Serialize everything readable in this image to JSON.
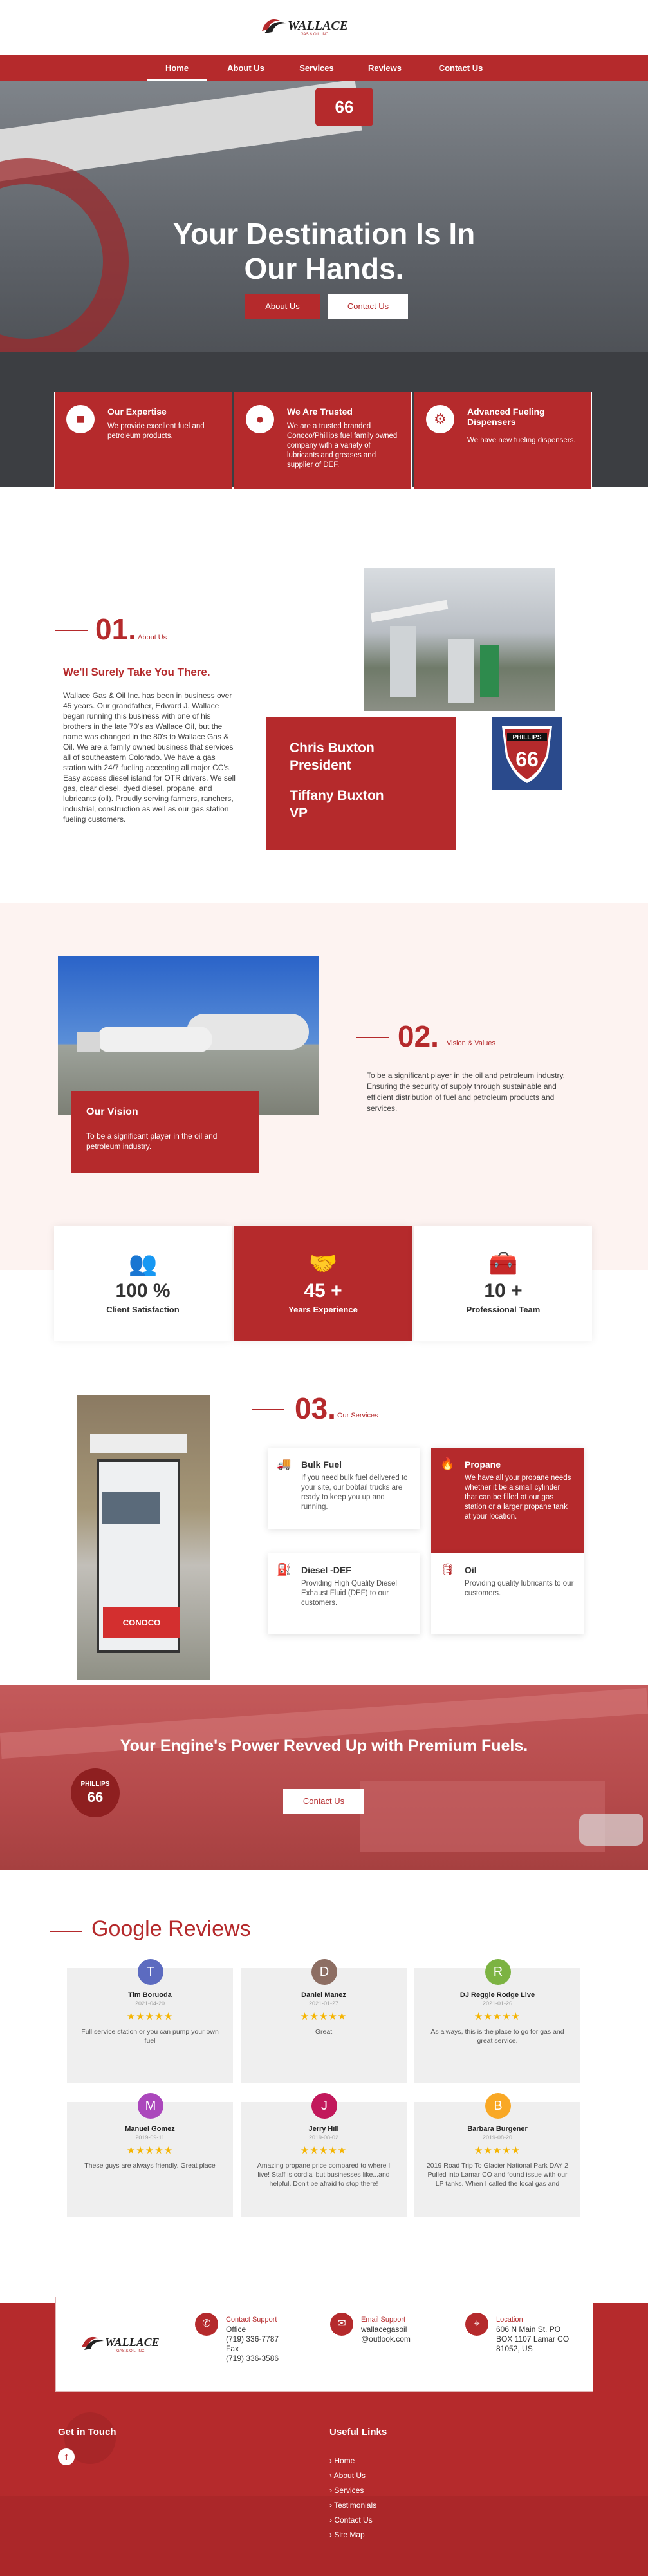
{
  "brand": {
    "name": "WALLACE",
    "sub": "GAS & OIL, INC.",
    "accent": "#b52a2c"
  },
  "nav": {
    "items": [
      {
        "label": "Home",
        "active": true
      },
      {
        "label": "About Us"
      },
      {
        "label": "Services"
      },
      {
        "label": "Reviews"
      },
      {
        "label": "Contact Us"
      }
    ]
  },
  "hero": {
    "title_line1": "Your Destination Is In",
    "title_line2": "Our Hands.",
    "about_btn": "About Us",
    "contact_btn": "Contact Us",
    "sign_text": "66"
  },
  "features": [
    {
      "title": "Our Expertise",
      "text": "We provide excellent fuel and petroleum products.",
      "icon": "briefcase-icon"
    },
    {
      "title": "We Are Trusted",
      "text": "We are a trusted branded Conoco/Phillips fuel family owned company with a variety of lubricants and greases and supplier of DEF.",
      "icon": "handshake-icon"
    },
    {
      "title": "Advanced Fueling Dispensers",
      "text": "We have new fueling dispensers.",
      "icon": "gears-icon"
    }
  ],
  "about": {
    "num": "01.",
    "label": "About Us",
    "heading": "We'll Surely Take You There.",
    "body": "Wallace Gas & Oil Inc. has been in business over 45 years. Our grandfather, Edward J. Wallace began running this business with one of his brothers in the late 70's as Wallace Oil, but the name was changed in the 80's to Wallace Gas & Oil. We are a family owned business that services all of southeastern Colorado. We have a gas station with 24/7 fueling accepting all major CC's. Easy access diesel island for OTR drivers. We sell gas, clear diesel, dyed diesel, propane, and lubricants (oil). Proudly serving farmers, ranchers, industrial, construction as well as our gas station fueling customers.",
    "leaders": [
      {
        "name": "Chris Buxton",
        "title": "President"
      },
      {
        "name": "Tiffany Buxton",
        "title": "VP"
      }
    ],
    "logo_text": "PHILLIPS",
    "logo_num": "66"
  },
  "vision": {
    "num": "02.",
    "label": "Vision & Values",
    "card_title": "Our Vision",
    "card_text": "To be a significant player in the oil and petroleum industry.",
    "text": "To be a significant player in the oil and petroleum industry. Ensuring the security of supply through sustainable and efficient distribution of fuel and petroleum products and services."
  },
  "stats": [
    {
      "num": "100 %",
      "label": "Client Satisfaction",
      "icon": "users-icon"
    },
    {
      "num": "45 +",
      "label": "Years Experience",
      "icon": "handshake-icon"
    },
    {
      "num": "10 +",
      "label": "Professional Team",
      "icon": "toolbox-icon"
    }
  ],
  "services": {
    "num": "03.",
    "label": "Our Services",
    "pump_brand": "CONOCO",
    "items": [
      {
        "title": "Bulk Fuel",
        "text": "If you need bulk fuel delivered to your site, our bobtail trucks are ready to keep you up and running.",
        "icon": "truck-icon"
      },
      {
        "title": "Propane",
        "text": "We have all your propane needs whether it be a small cylinder that can be filled at our gas station or a larger propane tank at your location.",
        "icon": "flame-icon"
      },
      {
        "title": "Diesel -DEF",
        "text": "Providing High Quality Diesel Exhaust Fluid (DEF) to our customers.",
        "icon": "fuel-pump-icon"
      },
      {
        "title": "Oil",
        "text": "Providing quality lubricants to our customers.",
        "icon": "oil-can-icon"
      }
    ]
  },
  "cta": {
    "title": "Your Engine's Power Revved Up with Premium Fuels.",
    "button": "Contact Us",
    "sign_brand": "PHILLIPS",
    "sign_num": "66"
  },
  "reviews": {
    "title": "Google Reviews",
    "items": [
      {
        "name": "Tim Boruoda",
        "date": "2021-04-20",
        "text": "Full service station or you can pump your own fuel",
        "initial": "T",
        "color": "#5c6bc0",
        "stars": "★★★★★"
      },
      {
        "name": "Daniel Manez",
        "date": "2021-01-27",
        "text": "Great",
        "initial": "D",
        "color": "#8d6e63",
        "stars": "★★★★★"
      },
      {
        "name": "DJ Reggie Rodge Live",
        "date": "2021-01-26",
        "text": "As always, this is the place to go for gas and great service.",
        "initial": "R",
        "color": "#7cb342",
        "stars": "★★★★★"
      },
      {
        "name": "Manuel Gomez",
        "date": "2019-09-11",
        "text": "These guys are always friendly. Great place",
        "initial": "M",
        "color": "#ab47bc",
        "stars": "★★★★★"
      },
      {
        "name": "Jerry Hill",
        "date": "2019-08-02",
        "text": "Amazing propane price compared to where I live! Staff is cordial but businesses like...and helpful. Don't be afraid to stop there!",
        "initial": "J",
        "color": "#c2185b",
        "stars": "★★★★★"
      },
      {
        "name": "Barbara Burgener",
        "date": "2019-08-20",
        "text": "2019 Road Trip To Glacier National Park DAY 2 Pulled into Lamar CO and found issue with our LP tanks. When I called the local gas and",
        "initial": "B",
        "color": "#f9a825",
        "stars": "★★★★★"
      }
    ]
  },
  "footer": {
    "support_label": "Contact Support",
    "office": "Office",
    "office_phone": "(719) 336-7787",
    "fax": "Fax",
    "fax_phone": "(719) 336-3586",
    "email_label": "Email Support",
    "email_user": "wallacegasoil",
    "email_domain": "@outlook.com",
    "location_label": "Location",
    "address1": "606 N Main St. PO",
    "address2": "BOX 1107 Lamar CO",
    "address3": "81052, US",
    "get_in_touch": "Get in Touch",
    "fb": "f",
    "useful_links": "Useful Links",
    "links": [
      "Home",
      "About Us",
      "Services",
      "Testimonials",
      "Contact Us",
      "Site Map"
    ]
  }
}
